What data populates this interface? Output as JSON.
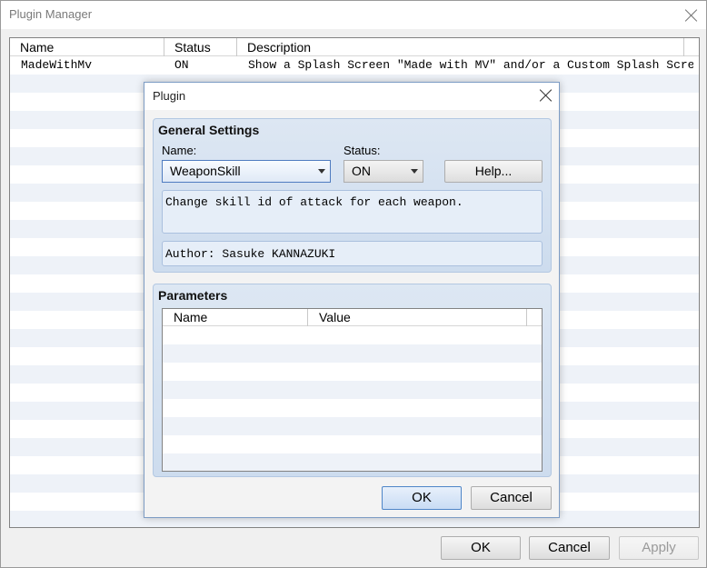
{
  "window": {
    "title": "Plugin Manager"
  },
  "plugin_table": {
    "columns": [
      "Name",
      "Status",
      "Description"
    ],
    "rows": [
      {
        "name": "MadeWithMv",
        "status": "ON",
        "description": "Show a Splash Screen \"Made with MV\" and/or a Custom Splash Screen …"
      }
    ]
  },
  "main_buttons": {
    "ok": "OK",
    "cancel": "Cancel",
    "apply": "Apply"
  },
  "dialog": {
    "title": "Plugin",
    "general": {
      "title": "General Settings",
      "name_label": "Name:",
      "name_value": "WeaponSkill",
      "status_label": "Status:",
      "status_value": "ON",
      "help_label": "Help...",
      "description": "Change skill id of attack for each weapon.",
      "author": "Author: Sasuke KANNAZUKI"
    },
    "parameters": {
      "title": "Parameters",
      "columns": [
        "Name",
        "Value"
      ]
    },
    "ok": "OK",
    "cancel": "Cancel"
  },
  "colors": {
    "accent_border": "#4f86c8",
    "group_bg": "#d6e2f1",
    "alt_row": "#eef2f8"
  }
}
